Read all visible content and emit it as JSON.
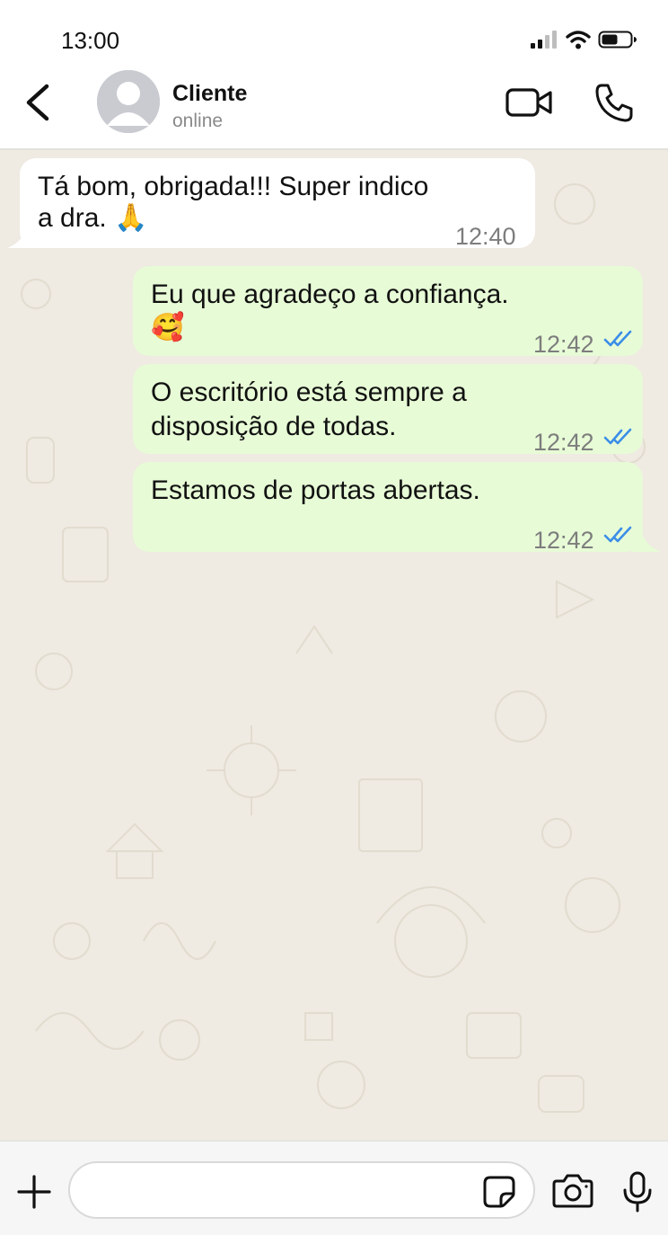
{
  "status_bar": {
    "time": "13:00"
  },
  "header": {
    "contact_name": "Cliente",
    "contact_status": "online"
  },
  "messages": [
    {
      "direction": "incoming",
      "text_lines": [
        "Tá bom, obrigada!!! Super indico",
        "a dra. 🙏"
      ],
      "time": "12:40"
    },
    {
      "direction": "outgoing",
      "text_lines": [
        "Eu que agradeço a confiança.",
        "🥰"
      ],
      "time": "12:42",
      "read": true
    },
    {
      "direction": "outgoing",
      "text_lines": [
        "O escritório está sempre a",
        "disposição de todas."
      ],
      "time": "12:42",
      "read": true
    },
    {
      "direction": "outgoing",
      "text_lines": [
        "Estamos de portas abertas."
      ],
      "time": "12:42",
      "read": true
    }
  ],
  "composer": {
    "input_value": "",
    "placeholder": ""
  },
  "icons": {
    "back": "chevron-left-icon",
    "avatar": "person-icon",
    "video": "video-camera-icon",
    "phone": "phone-icon",
    "plus": "plus-icon",
    "sticker": "sticker-icon",
    "camera": "camera-icon",
    "mic": "microphone-icon",
    "signal": "signal-icon",
    "wifi": "wifi-icon",
    "battery": "battery-icon"
  },
  "colors": {
    "chat_background": "#efeae2",
    "outgoing_bubble": "#e7fbd6",
    "incoming_bubble": "#ffffff",
    "read_ticks": "#3b8ee8",
    "timestamp": "#7d7d7d"
  }
}
